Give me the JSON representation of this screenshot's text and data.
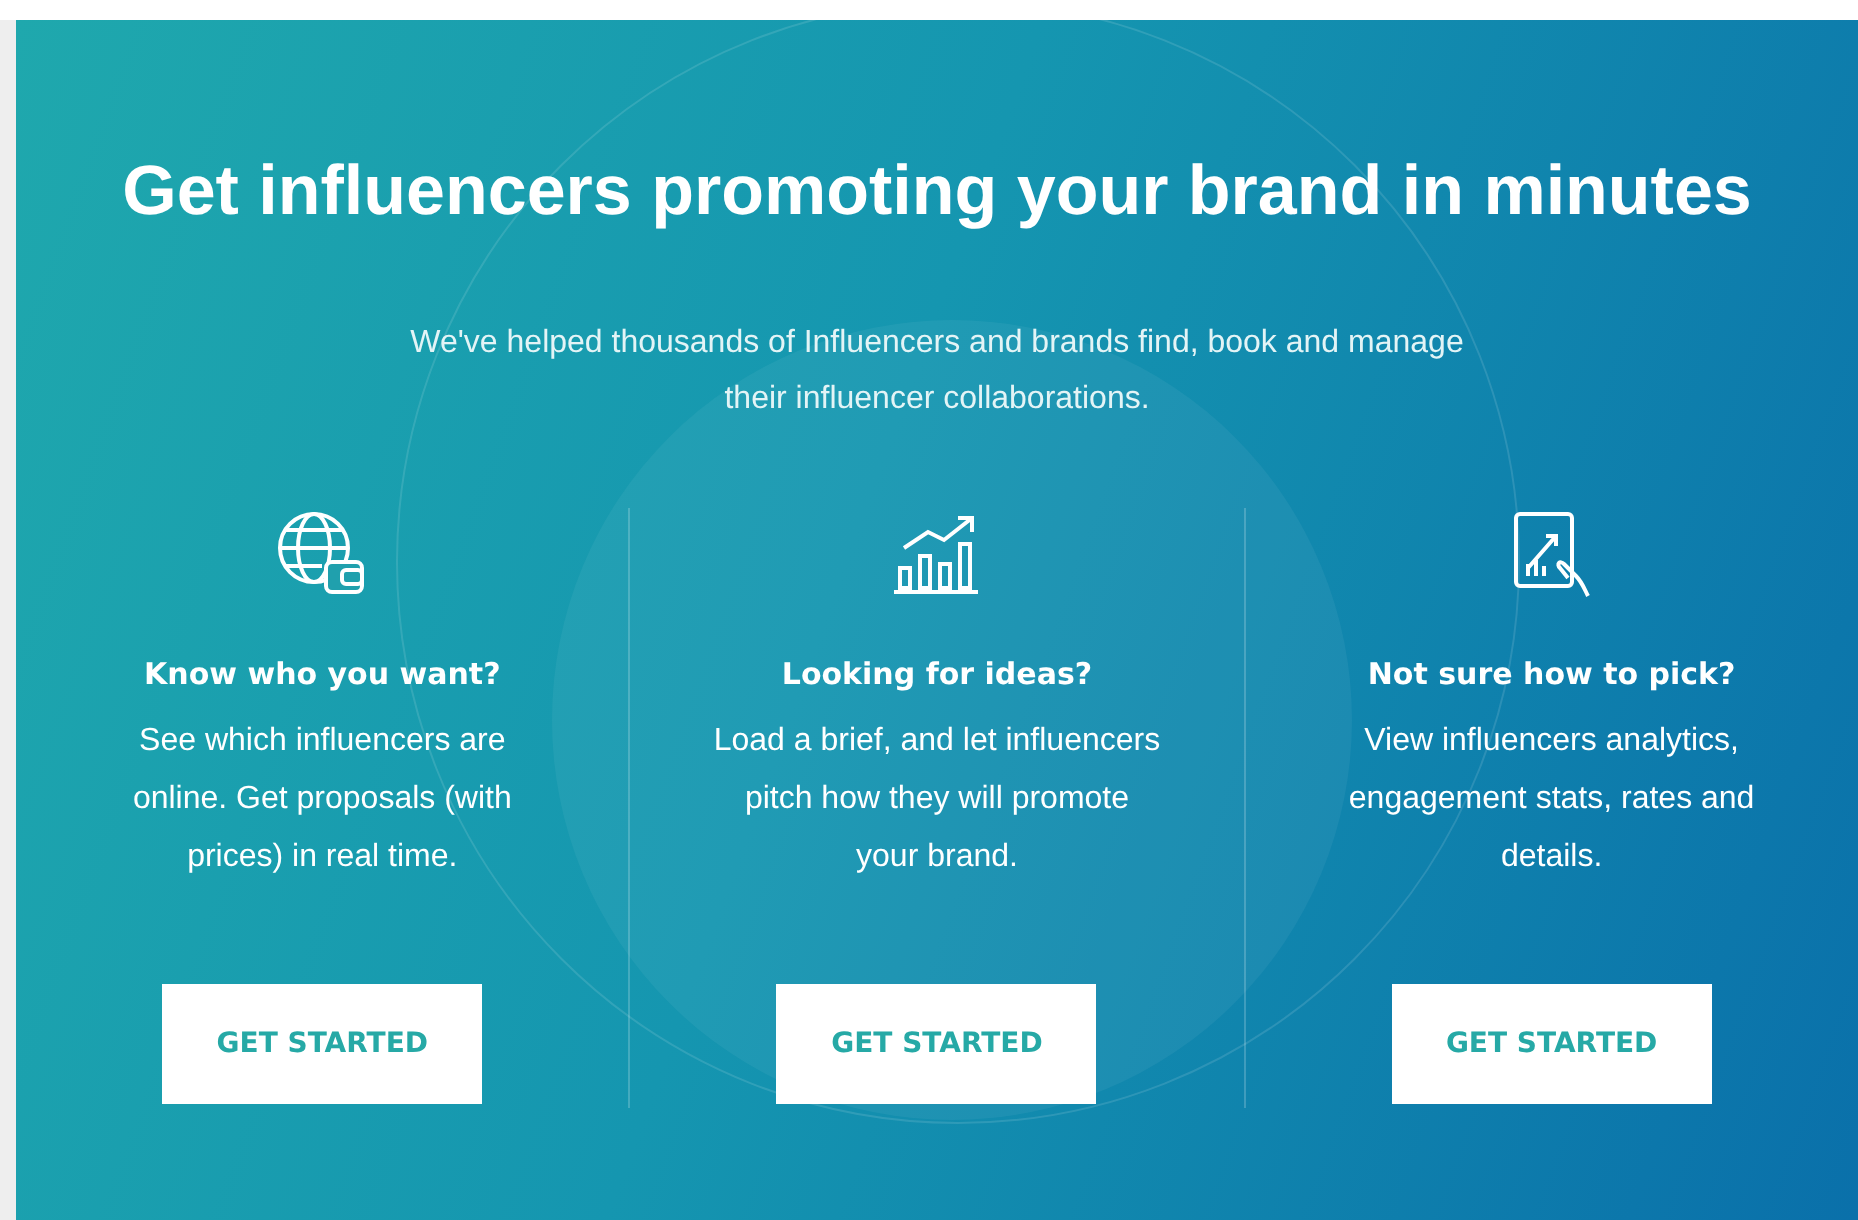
{
  "heading": "Get influencers promoting your brand in minutes",
  "subheading": "We've helped thousands of Influencers and brands find, book and manage their influencer collaborations.",
  "features": [
    {
      "title": "Know who you want?",
      "text": "See which influencers are online. Get proposals (with prices) in real time.",
      "button": "GET STARTED"
    },
    {
      "title": "Looking for ideas?",
      "text": "Load a brief, and let influencers pitch how they will promote your brand.",
      "button": "GET STARTED"
    },
    {
      "title": "Not sure how to pick?",
      "text": "View influencers analytics, engagement stats, rates and details.",
      "button": "GET STARTED"
    }
  ]
}
